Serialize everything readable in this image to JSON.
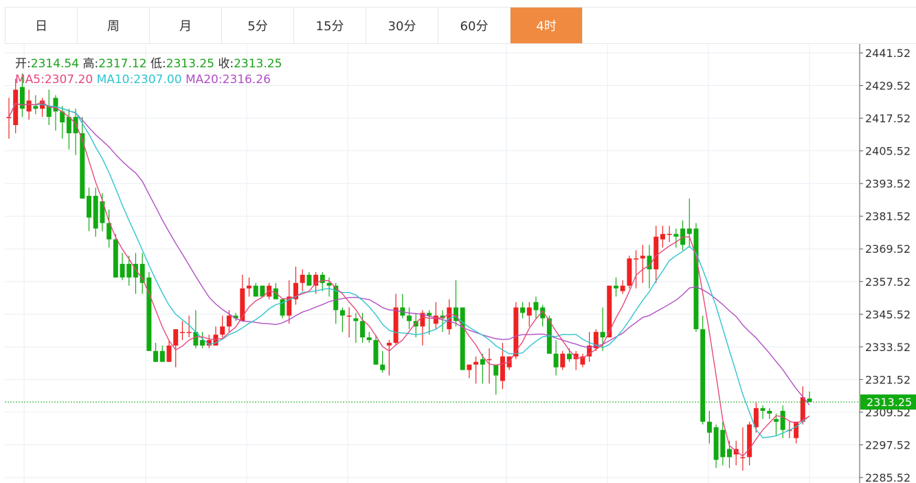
{
  "tabs": [
    "日",
    "周",
    "月",
    "5分",
    "15分",
    "30分",
    "60分",
    "4时"
  ],
  "active_tab": "4时",
  "colors": {
    "up": "#ee2222",
    "down": "#11aa11",
    "accent": "#f08a40",
    "ma5": "#e8487a",
    "ma10": "#2ec4cf",
    "ma20": "#b04fc4",
    "grid": "#e8eef3",
    "price_line": "#11aa11"
  },
  "info": {
    "open_label": "开:",
    "open": "2314.54",
    "high_label": "高:",
    "high": "2317.12",
    "low_label": "低:",
    "low": "2313.25",
    "close_label": "收:",
    "close": "2313.25",
    "ma5_label": "MA5:",
    "ma5": "2307.20",
    "ma10_label": "MA10:",
    "ma10": "2307.00",
    "ma20_label": "MA20:",
    "ma20": "2316.26"
  },
  "chart_data": {
    "type": "candlestick",
    "y_ticks": [
      "2441.52",
      "2429.52",
      "2417.52",
      "2405.52",
      "2393.52",
      "2381.52",
      "2369.52",
      "2357.52",
      "2345.52",
      "2333.52",
      "2321.52",
      "2309.52",
      "2297.52",
      "2285.52"
    ],
    "ylim": [
      2283.5,
      2444.8
    ],
    "current_price": "2313.25",
    "grid": true,
    "candles": [
      [
        2418,
        2425,
        2410,
        2418
      ],
      [
        2415,
        2432,
        2412,
        2428
      ],
      [
        2429,
        2434,
        2418,
        2421
      ],
      [
        2420,
        2428,
        2417,
        2424
      ],
      [
        2422,
        2426,
        2419,
        2421
      ],
      [
        2421,
        2425,
        2418,
        2424
      ],
      [
        2422,
        2428,
        2415,
        2418
      ],
      [
        2425,
        2426,
        2413,
        2420
      ],
      [
        2420,
        2422,
        2410,
        2416
      ],
      [
        2418,
        2421,
        2406,
        2412
      ],
      [
        2418,
        2421,
        2404,
        2412
      ],
      [
        2412,
        2418,
        2388,
        2388
      ],
      [
        2389,
        2392,
        2376,
        2381
      ],
      [
        2389,
        2392,
        2374,
        2377
      ],
      [
        2387,
        2390,
        2376,
        2379
      ],
      [
        2379,
        2384,
        2370,
        2373
      ],
      [
        2373,
        2375,
        2359,
        2359
      ],
      [
        2364,
        2368,
        2358,
        2359
      ],
      [
        2364,
        2367,
        2356,
        2359
      ],
      [
        2364,
        2368,
        2353,
        2359
      ],
      [
        2364,
        2368,
        2353,
        2357
      ],
      [
        2359,
        2361,
        2332,
        2332
      ],
      [
        2332,
        2335,
        2328,
        2328
      ],
      [
        2332,
        2334,
        2328,
        2328
      ],
      [
        2328,
        2336,
        2328,
        2334
      ],
      [
        2334,
        2340,
        2326,
        2340
      ],
      [
        2339,
        2343,
        2336,
        2339
      ],
      [
        2339,
        2345,
        2337,
        2339
      ],
      [
        2339,
        2347,
        2333,
        2334
      ],
      [
        2336,
        2339,
        2333,
        2334
      ],
      [
        2334,
        2338,
        2333,
        2336
      ],
      [
        2334,
        2341,
        2334,
        2338
      ],
      [
        2338,
        2345,
        2337,
        2341
      ],
      [
        2341,
        2347,
        2339,
        2345
      ],
      [
        2345,
        2346,
        2343,
        2344
      ],
      [
        2343,
        2360,
        2343,
        2355
      ],
      [
        2355,
        2359,
        2352,
        2356
      ],
      [
        2356,
        2357,
        2352,
        2352
      ],
      [
        2356,
        2356,
        2352,
        2352
      ],
      [
        2352,
        2357,
        2351,
        2356
      ],
      [
        2355,
        2357,
        2352,
        2351
      ],
      [
        2351,
        2351,
        2344,
        2345
      ],
      [
        2345,
        2358,
        2342,
        2352
      ],
      [
        2351,
        2363,
        2349,
        2357
      ],
      [
        2357,
        2362,
        2354,
        2360
      ],
      [
        2360,
        2361,
        2357,
        2356
      ],
      [
        2356,
        2361,
        2353,
        2360
      ],
      [
        2360,
        2361,
        2354,
        2357
      ],
      [
        2357,
        2359,
        2352,
        2356
      ],
      [
        2356,
        2357,
        2342,
        2347
      ],
      [
        2347,
        2348,
        2339,
        2345
      ],
      [
        2345,
        2348,
        2337,
        2345
      ],
      [
        2344,
        2346,
        2335,
        2343
      ],
      [
        2343,
        2346,
        2335,
        2337
      ],
      [
        2337,
        2339,
        2335,
        2336
      ],
      [
        2336,
        2338,
        2327,
        2327
      ],
      [
        2327,
        2332,
        2324,
        2325
      ],
      [
        2334,
        2336,
        2323,
        2335
      ],
      [
        2335,
        2353,
        2334,
        2348
      ],
      [
        2348,
        2353,
        2344,
        2345
      ],
      [
        2345,
        2348,
        2340,
        2343
      ],
      [
        2343,
        2346,
        2337,
        2341
      ],
      [
        2341,
        2347,
        2334,
        2346
      ],
      [
        2346,
        2347,
        2338,
        2345
      ],
      [
        2342,
        2350,
        2340,
        2345
      ],
      [
        2345,
        2347,
        2339,
        2344
      ],
      [
        2340,
        2351,
        2338,
        2348
      ],
      [
        2348,
        2358,
        2341,
        2343
      ],
      [
        2348,
        2348,
        2329,
        2325
      ],
      [
        2325,
        2327,
        2322,
        2327
      ],
      [
        2327,
        2330,
        2320,
        2328
      ],
      [
        2329,
        2331,
        2320,
        2327
      ],
      [
        2329,
        2333,
        2320,
        2329
      ],
      [
        2327,
        2327,
        2316,
        2323
      ],
      [
        2321,
        2335,
        2318,
        2330
      ],
      [
        2326,
        2330,
        2325,
        2330
      ],
      [
        2330,
        2350,
        2329,
        2348
      ],
      [
        2348,
        2350,
        2344,
        2346
      ],
      [
        2345,
        2350,
        2341,
        2348
      ],
      [
        2350,
        2352,
        2344,
        2347
      ],
      [
        2348,
        2349,
        2341,
        2344
      ],
      [
        2344,
        2345,
        2331,
        2331
      ],
      [
        2331,
        2336,
        2323,
        2326
      ],
      [
        2326,
        2332,
        2325,
        2331
      ],
      [
        2331,
        2333,
        2328,
        2329
      ],
      [
        2329,
        2332,
        2325,
        2331
      ],
      [
        2327,
        2331,
        2326,
        2330
      ],
      [
        2330,
        2339,
        2328,
        2334
      ],
      [
        2333,
        2340,
        2332,
        2339
      ],
      [
        2339,
        2348,
        2332,
        2337
      ],
      [
        2337,
        2356,
        2337,
        2356
      ],
      [
        2356,
        2359,
        2352,
        2355
      ],
      [
        2354,
        2358,
        2353,
        2356
      ],
      [
        2356,
        2367,
        2355,
        2366
      ],
      [
        2366,
        2369,
        2355,
        2366
      ],
      [
        2366,
        2371,
        2357,
        2367
      ],
      [
        2367,
        2371,
        2355,
        2362
      ],
      [
        2362,
        2378,
        2357,
        2374
      ],
      [
        2373,
        2378,
        2370,
        2375
      ],
      [
        2375,
        2378,
        2372,
        2375
      ],
      [
        2375,
        2377,
        2370,
        2374
      ],
      [
        2377,
        2380,
        2369,
        2371
      ],
      [
        2377,
        2388,
        2370,
        2375
      ],
      [
        2377,
        2379,
        2339,
        2340
      ],
      [
        2340,
        2345,
        2305,
        2306
      ],
      [
        2306,
        2310,
        2298,
        2302
      ],
      [
        2304,
        2305,
        2289,
        2292
      ],
      [
        2303,
        2306,
        2290,
        2293
      ],
      [
        2296,
        2299,
        2289,
        2293
      ],
      [
        2294,
        2299,
        2290,
        2296
      ],
      [
        2293,
        2304,
        2288,
        2293
      ],
      [
        2293,
        2306,
        2290,
        2305
      ],
      [
        2304,
        2313,
        2302,
        2311
      ],
      [
        2311,
        2312,
        2307,
        2310
      ],
      [
        2310,
        2311,
        2307,
        2309
      ],
      [
        2307,
        2309,
        2301,
        2306
      ],
      [
        2310,
        2312,
        2300,
        2303
      ],
      [
        2303,
        2306,
        2300,
        2303
      ],
      [
        2300,
        2306,
        2298,
        2306
      ],
      [
        2306,
        2319,
        2305,
        2315
      ],
      [
        2314.54,
        2317.12,
        2313.25,
        2313.25
      ]
    ]
  }
}
